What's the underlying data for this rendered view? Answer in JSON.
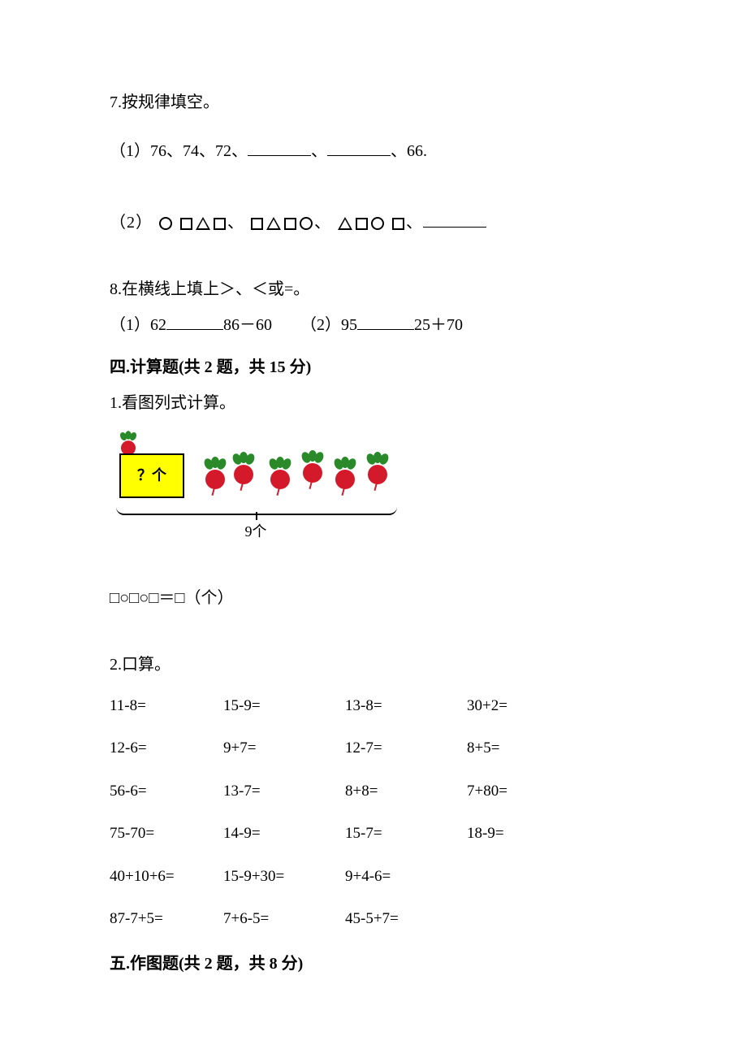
{
  "q7": {
    "title": "7.按规律填空。",
    "part1_prefix": "（1）76、74、72、",
    "part1_suffix": "、66.",
    "part2_prefix": "（2）",
    "sep": "、"
  },
  "q8": {
    "title": "8.在横线上填上＞、＜或=。",
    "p1a": "（1）62",
    "p1b": "86－60",
    "p2a": "（2）95",
    "p2b": "25＋70"
  },
  "s4": {
    "heading": "四.计算题(共 2 题，共 15 分)",
    "q1": "1.看图列式计算。",
    "box_label": "？个",
    "bracket_label": "9个",
    "answer_line": "□○□○□＝□（个）",
    "q2": "2.口算。",
    "calc": [
      [
        "11-8=",
        "15-9=",
        "13-8=",
        "30+2="
      ],
      [
        "12-6=",
        "9+7=",
        "12-7=",
        "8+5="
      ],
      [
        "56-6=",
        "13-7=",
        "8+8=",
        "7+80="
      ],
      [
        "75-70=",
        "14-9=",
        "15-7=",
        "18-9="
      ],
      [
        "40+10+6=",
        "15-9+30=",
        "9+4-6=",
        ""
      ],
      [
        "87-7+5=",
        "7+6-5=",
        "45-5+7=",
        ""
      ]
    ]
  },
  "s5": {
    "heading": "五.作图题(共 2 题，共 8 分)"
  }
}
